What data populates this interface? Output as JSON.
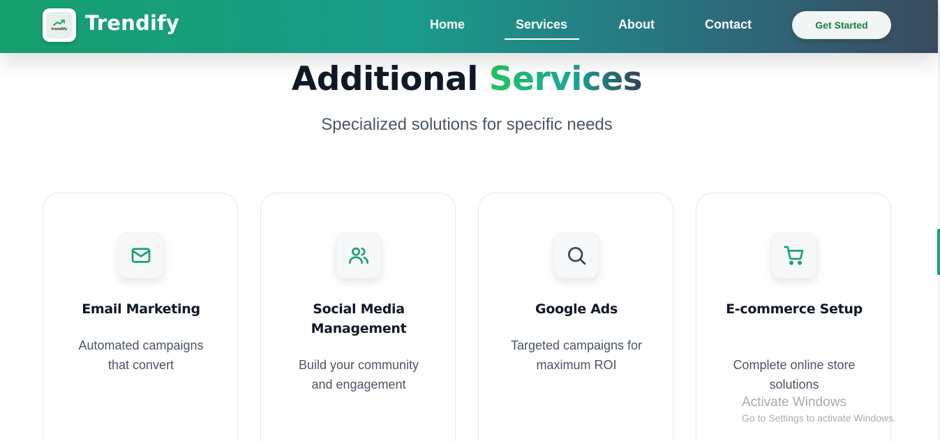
{
  "navbar": {
    "logo_icon": "trend-chart-icon",
    "logo_mini_text": "trendify",
    "brand": "Trendify",
    "links": [
      "Home",
      "Services",
      "About",
      "Contact"
    ],
    "active_link": "Services",
    "cta_label": "Get Started",
    "colors": {
      "gradient_start": "#16a06e",
      "gradient_end": "#3b4a5e"
    }
  },
  "section": {
    "title_main": "Additional",
    "title_accent": "Services",
    "subtitle": "Specialized solutions for specific needs"
  },
  "cards": [
    {
      "icon": "mail-icon",
      "title": "Email Marketing",
      "description": "Automated campaigns that convert"
    },
    {
      "icon": "users-icon",
      "title": "Social Media Management",
      "description": "Build your community and engagement"
    },
    {
      "icon": "search-icon",
      "title": "Google Ads",
      "description": "Targeted campaigns for maximum ROI"
    },
    {
      "icon": "shopping-cart-icon",
      "title": "E-commerce Setup",
      "description": "Complete online store solutions"
    }
  ],
  "os_watermark": {
    "title": "Activate Windows",
    "subtitle": "Go to Settings to activate Windows."
  },
  "accent_color": "#16a06e"
}
